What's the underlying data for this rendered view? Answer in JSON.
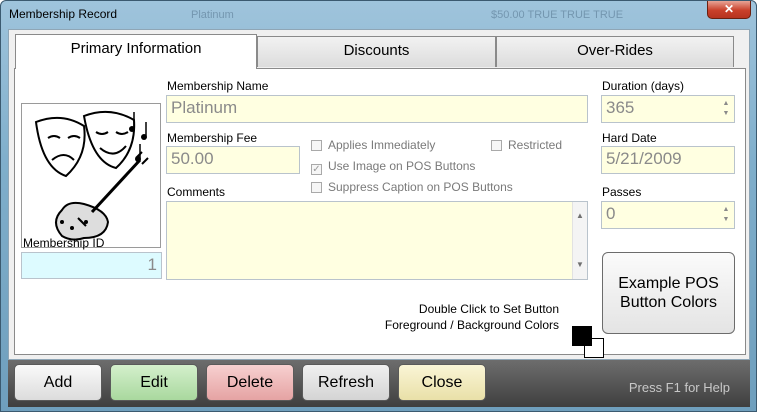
{
  "window": {
    "title": "Membership Record",
    "ghost_texts": [
      "Platinum",
      "$50.00 TRUE TRUE TRUE"
    ],
    "close_glyph": "✕"
  },
  "tabs": [
    {
      "label": "Primary Information",
      "active": true
    },
    {
      "label": "Discounts",
      "active": false
    },
    {
      "label": "Over-Rides",
      "active": false
    }
  ],
  "form": {
    "image_description_icon": "theater-masks-violin-icon",
    "membership_name_label": "Membership Name",
    "membership_name_value": "Platinum",
    "membership_fee_label": "Membership Fee",
    "membership_fee_value": "50.00",
    "comments_label": "Comments",
    "comments_value": "",
    "membership_id_label": "Membership ID",
    "membership_id_value": "1",
    "duration_label": "Duration (days)",
    "duration_value": "365",
    "hard_date_label": "Hard Date",
    "hard_date_value": "5/21/2009",
    "passes_label": "Passes",
    "passes_value": "0",
    "checkboxes": {
      "applies_immediately": {
        "label": "Applies Immediately",
        "checked": false
      },
      "restricted": {
        "label": "Restricted",
        "checked": false
      },
      "use_image": {
        "label": "Use Image on POS Buttons",
        "checked": true
      },
      "suppress_caption": {
        "label": "Suppress Caption on POS Buttons",
        "checked": false
      }
    },
    "example_button_label": "Example POS Button Colors",
    "color_hint_line1": "Double Click to Set Button",
    "color_hint_line2": "Foreground / Background Colors",
    "foreground_color": "#000000",
    "background_color": "#ffffff"
  },
  "buttons": [
    {
      "label": "Add",
      "color": "#f2f2f2"
    },
    {
      "label": "Edit",
      "color": "#b9e3b0"
    },
    {
      "label": "Delete",
      "color": "#f0b8b8"
    },
    {
      "label": "Refresh",
      "color": "#e4e4e4"
    },
    {
      "label": "Close",
      "color": "#f5efc2"
    }
  ],
  "help_text": "Press F1 for Help"
}
